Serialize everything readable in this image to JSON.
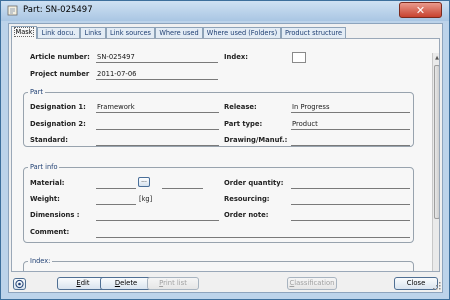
{
  "window": {
    "title": "Part: SN-025497",
    "close_glyph": "✕"
  },
  "tabs": [
    {
      "label": "Mask",
      "active": true
    },
    {
      "label": "Link docu."
    },
    {
      "label": "Links"
    },
    {
      "label": "Link sources"
    },
    {
      "label": "Where used"
    },
    {
      "label": "Where used (Folders)"
    },
    {
      "label": "Product structure"
    }
  ],
  "header": {
    "article_number_label": "Article number:",
    "article_number_value": "SN-025497",
    "index_label": "Index:",
    "index_value": "",
    "project_number_label": "Project number",
    "project_number_value": "2011-07-06"
  },
  "part_group": {
    "title": "Part",
    "designation1_label": "Designation 1:",
    "designation1_value": "Framework",
    "release_label": "Release:",
    "release_value": "In Progress",
    "designation2_label": "Designation 2:",
    "designation2_value": "",
    "part_type_label": "Part type:",
    "part_type_value": "Product",
    "standard_label": "Standard:",
    "standard_value": "",
    "drawing_label": "Drawing/Manuf.:",
    "drawing_value": ""
  },
  "part_info_group": {
    "title": "Part info",
    "material_label": "Material:",
    "material_value": "",
    "material_extra_value": "",
    "material_button": "...",
    "order_quantity_label": "Order quantity:",
    "order_quantity_value": "",
    "weight_label": "Weight:",
    "weight_value": "",
    "weight_unit": "[kg]",
    "resourcing_label": "Resourcing:",
    "resourcing_value": "",
    "dimensions_label": "Dimensions :",
    "dimensions_value": "",
    "order_note_label": "Order note:",
    "order_note_value": "",
    "comment_label": "Comment:",
    "comment_value": ""
  },
  "index_group": {
    "title": "Index:"
  },
  "buttons": {
    "edit_hotkey": "E",
    "edit_rest": "dit",
    "delete_hotkey": "D",
    "delete_rest": "elete",
    "print_hotkey": "P",
    "print_rest": "rint list",
    "classification_hotkey": "C",
    "classification_rest": "lassification",
    "close": "Close"
  },
  "icons": [
    "app-icon",
    "close-icon",
    "help-icon",
    "scroll-up-icon",
    "scroll-down-icon",
    "resize-grip-icon"
  ]
}
